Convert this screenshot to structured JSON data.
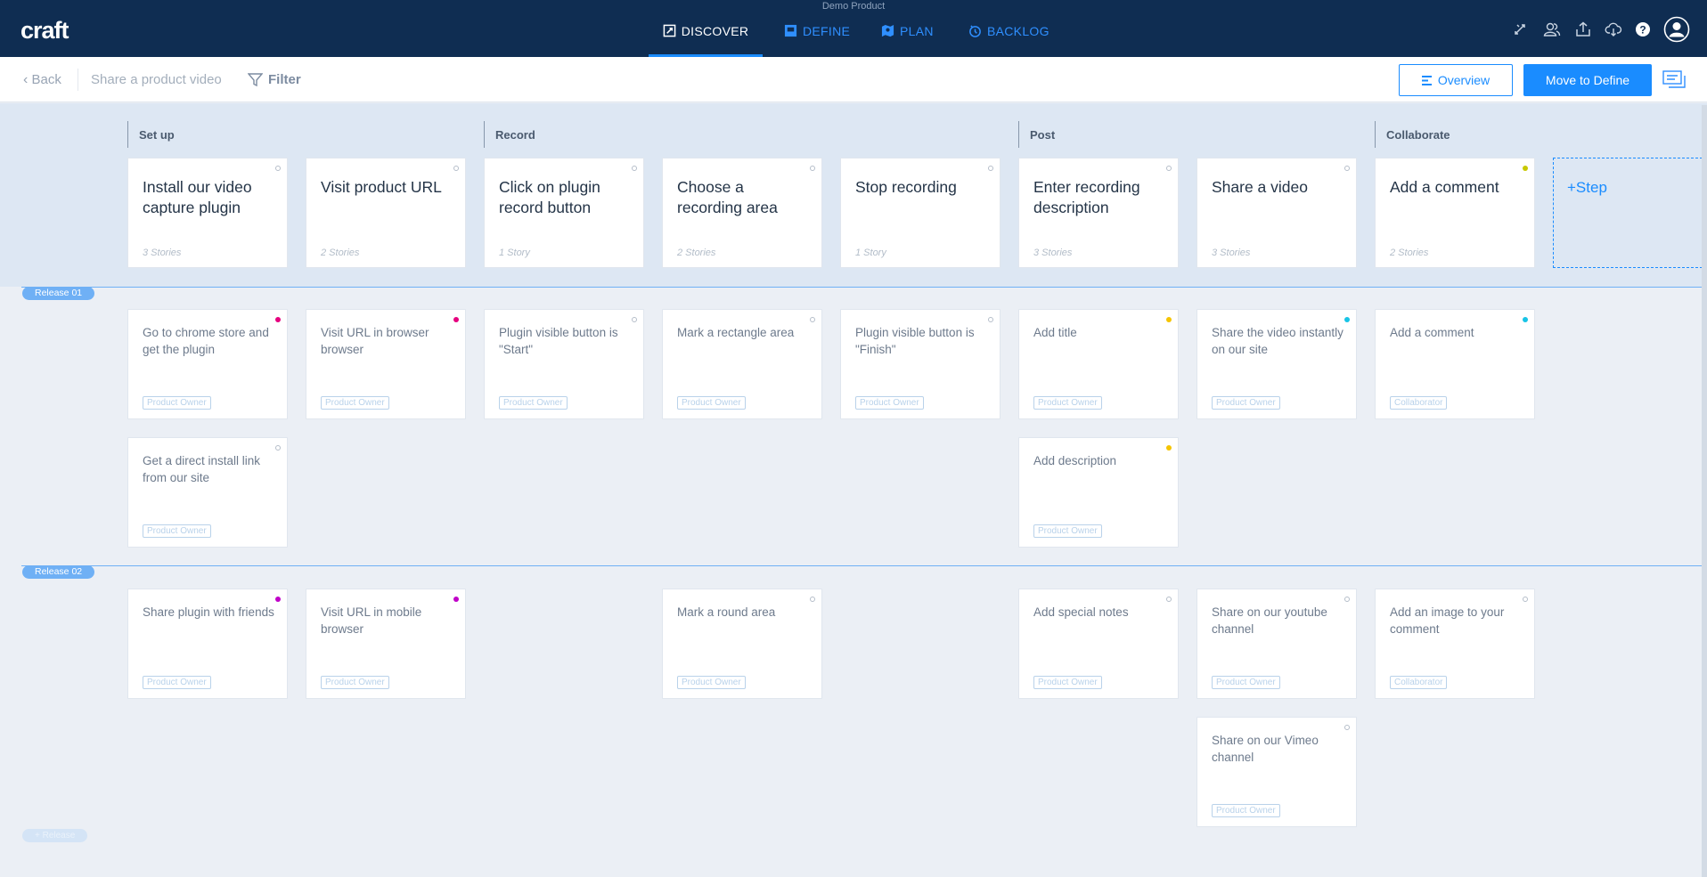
{
  "header": {
    "product_name": "Demo Product",
    "logo": "craft",
    "tabs": [
      {
        "label": "DISCOVER",
        "icon": "discover-icon",
        "active": true
      },
      {
        "label": "DEFINE",
        "icon": "define-icon",
        "active": false
      },
      {
        "label": "PLAN",
        "icon": "plan-icon",
        "active": false
      },
      {
        "label": "BACKLOG",
        "icon": "backlog-icon",
        "active": false
      }
    ],
    "right_icons": [
      "sync-icon",
      "users-icon",
      "upload-icon",
      "cloud-download-icon",
      "help-icon",
      "profile-icon"
    ]
  },
  "toolbar": {
    "back_label": "Back",
    "page_title": "Share a product video",
    "filter_label": "Filter",
    "overview_label": "Overview",
    "move_label": "Move to Define"
  },
  "activities": [
    "Set up",
    "Record",
    "Post",
    "Collaborate"
  ],
  "steps": [
    {
      "title": "Install our video capture plugin",
      "count": "3 Stories",
      "dot": "hollow"
    },
    {
      "title": "Visit product URL",
      "count": "2 Stories",
      "dot": "hollow"
    },
    {
      "title": "Click on plugin record button",
      "count": "1 Story",
      "dot": "hollow"
    },
    {
      "title": "Choose a recording area",
      "count": "2 Stories",
      "dot": "hollow"
    },
    {
      "title": "Stop recording",
      "count": "1 Story",
      "dot": "hollow"
    },
    {
      "title": "Enter recording description",
      "count": "3 Stories",
      "dot": "hollow"
    },
    {
      "title": "Share a video",
      "count": "3 Stories",
      "dot": "hollow"
    },
    {
      "title": "Add a comment",
      "count": "2 Stories",
      "dot": "#c8c800"
    }
  ],
  "add_step_label": "+Step",
  "releases": [
    {
      "label": "Release 01",
      "stories": [
        {
          "title": "Go to chrome store and get the plugin",
          "persona": "Product Owner",
          "dot": "#e6007e"
        },
        {
          "title": "Visit URL in browser browser",
          "persona": "Product Owner",
          "dot": "#e6007e"
        },
        {
          "title": "Plugin visible button is \"Start\"",
          "persona": "Product Owner",
          "dot": "hollow"
        },
        {
          "title": "Mark a rectangle area",
          "persona": "Product Owner",
          "dot": "hollow"
        },
        {
          "title": "Plugin visible button is \"Finish\"",
          "persona": "Product Owner",
          "dot": "hollow"
        },
        {
          "title": "Add title",
          "persona": "Product Owner",
          "dot": "#f5c400"
        },
        {
          "title": "Share the video instantly on our site",
          "persona": "Product Owner",
          "dot": "#18c4e6"
        },
        {
          "title": "Add a comment",
          "persona": "Collaborator",
          "dot": "#18c4e6"
        },
        {
          "title": "Get a direct install link from our site",
          "persona": "Product Owner",
          "dot": "hollow"
        },
        {
          "title": "Add description",
          "persona": "Product Owner",
          "dot": "#f5c400"
        }
      ]
    },
    {
      "label": "Release 02",
      "stories": [
        {
          "title": "Share plugin with friends",
          "persona": "Product Owner",
          "dot": "#c000c8"
        },
        {
          "title": "Visit URL in mobile browser",
          "persona": "Product Owner",
          "dot": "#c000c8"
        },
        {
          "title": "Mark a round area",
          "persona": "Product Owner",
          "dot": "hollow"
        },
        {
          "title": "Add special notes",
          "persona": "Product Owner",
          "dot": "hollow"
        },
        {
          "title": "Share on our youtube channel",
          "persona": "Product Owner",
          "dot": "hollow"
        },
        {
          "title": "Add an image to your comment",
          "persona": "Collaborator",
          "dot": "hollow"
        },
        {
          "title": "Share on our Vimeo channel",
          "persona": "Product Owner",
          "dot": "hollow"
        }
      ]
    }
  ],
  "add_release_label": "+ Release"
}
